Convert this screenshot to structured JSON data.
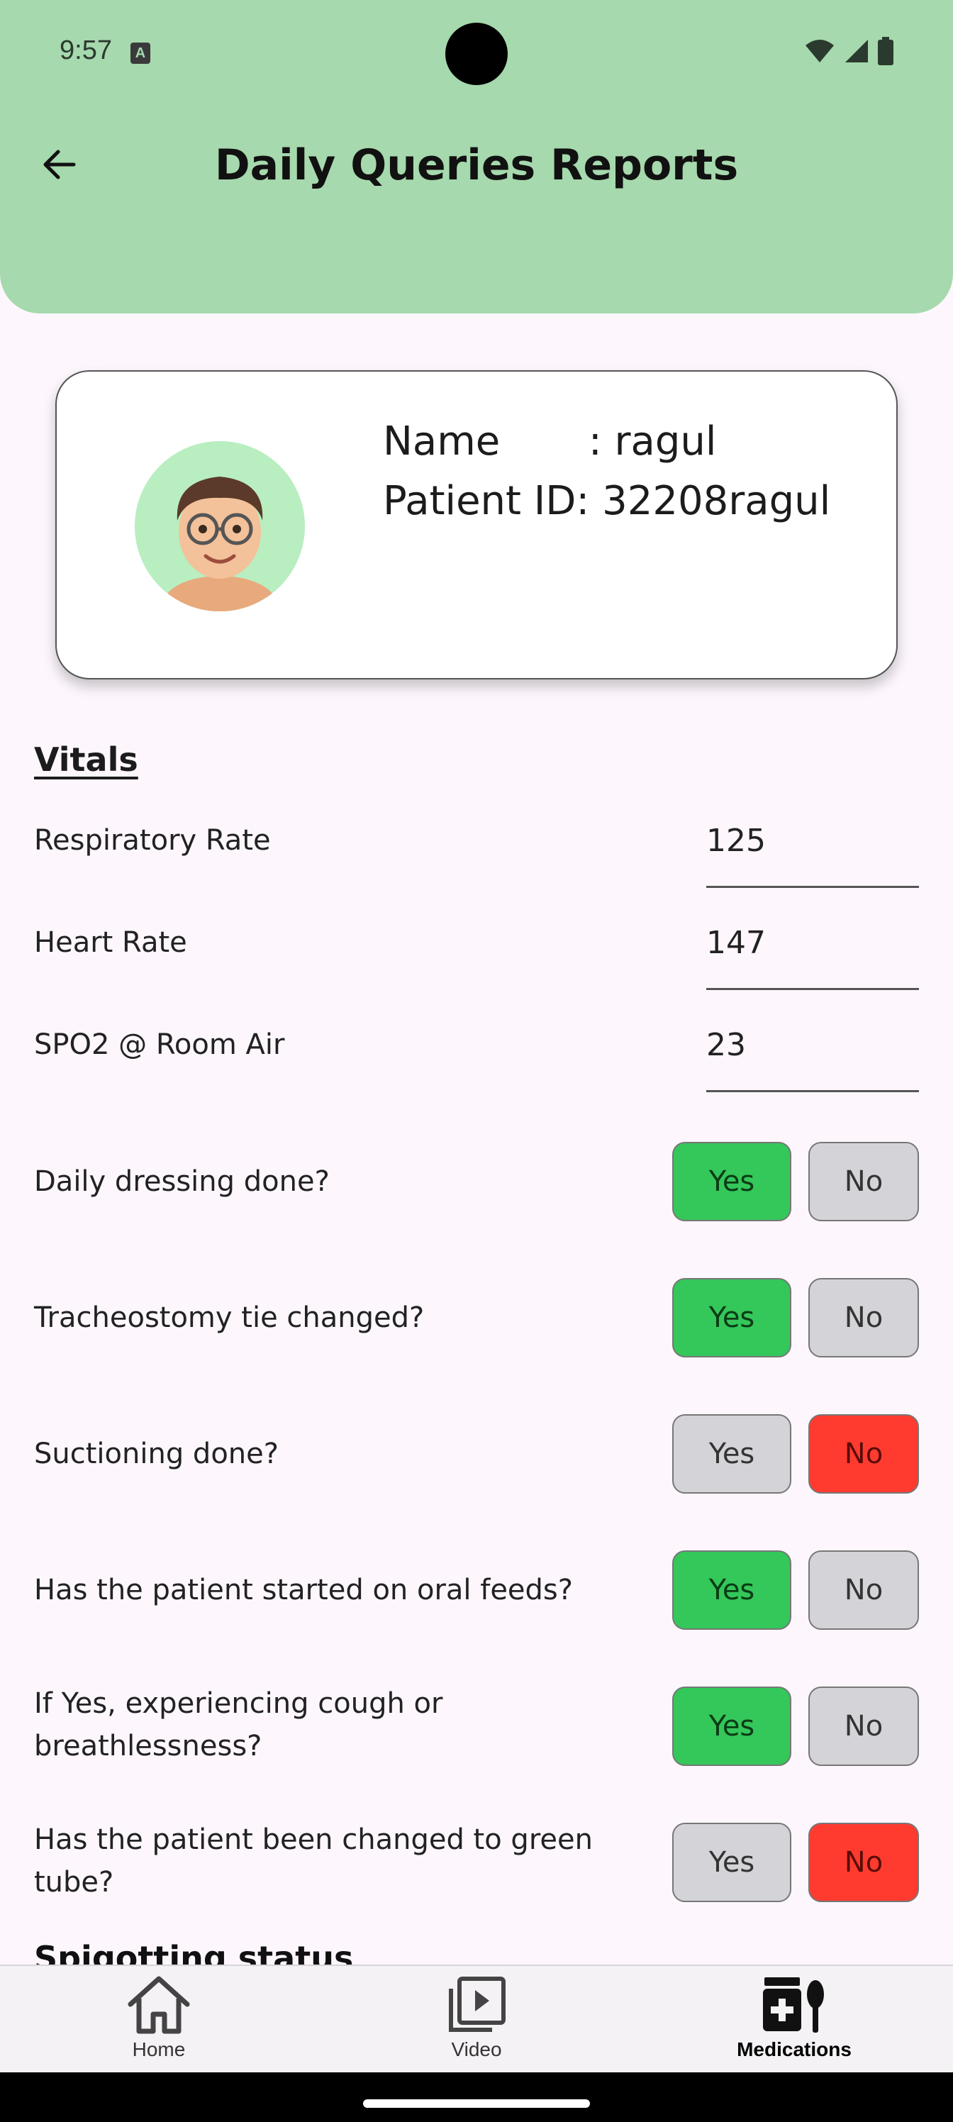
{
  "status_bar": {
    "time": "9:57",
    "badge": "A"
  },
  "header": {
    "title": "Daily Queries Reports"
  },
  "patient": {
    "name_line": "Name       : ragul",
    "id_line": "Patient ID: 32208ragul"
  },
  "vitals": {
    "title": "Vitals",
    "items": [
      {
        "label": "Respiratory Rate",
        "value": "125"
      },
      {
        "label": "Heart Rate",
        "value": "147"
      },
      {
        "label": "SPO2 @ Room Air",
        "value": "23"
      }
    ]
  },
  "questions": {
    "yes_label": "Yes",
    "no_label": "No",
    "items": [
      {
        "label": "Daily dressing done?",
        "selected": "yes"
      },
      {
        "label": "Tracheostomy tie changed?",
        "selected": "yes"
      },
      {
        "label": "Suctioning done?",
        "selected": "no"
      },
      {
        "label": "Has the patient started on oral feeds?",
        "selected": "yes"
      },
      {
        "label": "If Yes, experiencing cough or breathlessness?",
        "selected": "yes"
      },
      {
        "label": "Has the patient been changed to green tube?",
        "selected": "no"
      }
    ]
  },
  "next_section": "Spigotting status",
  "bottom_nav": {
    "home": "Home",
    "video": "Video",
    "medications": "Medications",
    "active": "medications"
  },
  "colors": {
    "header": "#a6d9ad",
    "yes_selected": "#34c759",
    "no_selected": "#ff3b30",
    "unselected": "#d3d3d8"
  }
}
